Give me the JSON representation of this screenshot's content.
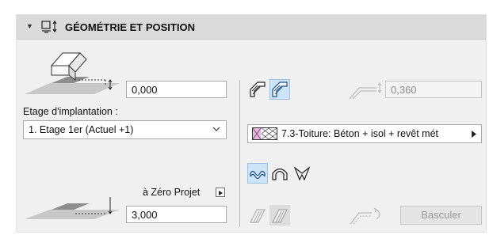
{
  "section": {
    "title": "GÉOMÉTRIE ET POSITION",
    "collapse_icon": "triangle-down-icon",
    "header_icon": "geometry-position-icon"
  },
  "left": {
    "top_offset_value": "0,000",
    "floor_label": "Etage d'implantation :",
    "floor_selected": "1. Etage 1er (Actuel +1)",
    "reference_label": "à Zéro Projet",
    "bottom_offset_value": "3,000"
  },
  "right": {
    "thickness_value": "0,360",
    "material_name": "7.3-Toiture: Béton + isol + revêt mét",
    "flip_label": "Basculer"
  },
  "colors": {
    "header_bg": "#dadada",
    "panel_bg": "#f0f0f0",
    "active_blue": "#cde3f7"
  }
}
